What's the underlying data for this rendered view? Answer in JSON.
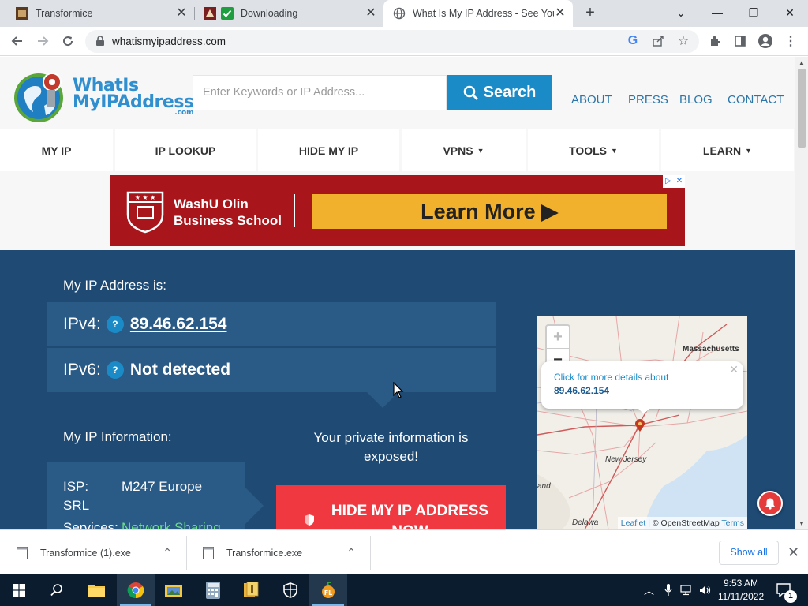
{
  "browser": {
    "tabs": [
      {
        "title": "Transformice",
        "favicon": "transformice-favicon",
        "active": false
      },
      {
        "title": "Downloading",
        "favicon": "green-check-favicon",
        "active": false
      },
      {
        "title": "What Is My IP Address - See Your",
        "favicon": "globe-favicon",
        "active": true
      }
    ],
    "url": "whatismyipaddress.com"
  },
  "site": {
    "logo": {
      "line1": "WhatIs",
      "line2": "MyIPAddress",
      "suffix": ".com"
    },
    "search": {
      "placeholder": "Enter Keywords or IP Address...",
      "button_label": "Search"
    },
    "top_links": [
      "ABOUT",
      "PRESS",
      "BLOG",
      "CONTACT"
    ],
    "nav": [
      {
        "label": "MY IP",
        "has_dropdown": false
      },
      {
        "label": "IP LOOKUP",
        "has_dropdown": false
      },
      {
        "label": "HIDE MY IP",
        "has_dropdown": false
      },
      {
        "label": "VPNS",
        "has_dropdown": true
      },
      {
        "label": "TOOLS",
        "has_dropdown": true
      },
      {
        "label": "LEARN",
        "has_dropdown": true
      }
    ],
    "ad": {
      "line1": "WashU Olin",
      "line2": "Business School",
      "cta": "Learn More ▶"
    },
    "ip": {
      "heading": "My IP Address is:",
      "ipv4_label": "IPv4:",
      "ipv4_value": "89.46.62.154",
      "ipv6_label": "IPv6:",
      "ipv6_value": "Not detected",
      "help_glyph": "?"
    },
    "info": {
      "heading": "My IP Information:",
      "isp_label": "ISP:",
      "isp_value_line1": "M247 Europe",
      "isp_value_line2": "SRL",
      "services_label": "Services:",
      "services_value": "Network Sharing"
    },
    "exposed_text": "Your private information is exposed!",
    "hide_button": {
      "line1": "HIDE MY IP ADDRESS",
      "line2": "NOW"
    },
    "map": {
      "popup_line1": "Click for more details about",
      "popup_ip": "89.46.62.154",
      "labels": {
        "massachusetts": "Massachusetts",
        "new_jersey": "New Jersey",
        "land": "and",
        "delaware": "Delawa"
      },
      "attribution_leaflet": "Leaflet",
      "attribution_sep": "| ©",
      "attribution_osm": "OpenStreetMap",
      "attribution_terms": "Terms",
      "zoom_in": "+",
      "zoom_out": "−"
    }
  },
  "downloads": {
    "items": [
      "Transformice (1).exe",
      "Transformice.exe"
    ],
    "show_all": "Show all"
  },
  "taskbar": {
    "time": "9:53 AM",
    "date": "11/11/2022",
    "notification_count": "1"
  },
  "colors": {
    "brand_blue": "#1b8bc8",
    "ip_section_bg": "#1e4a74",
    "hide_button_red": "#ef3840",
    "ad_red": "#a8151b",
    "ad_cta_yellow": "#f2b12c"
  }
}
